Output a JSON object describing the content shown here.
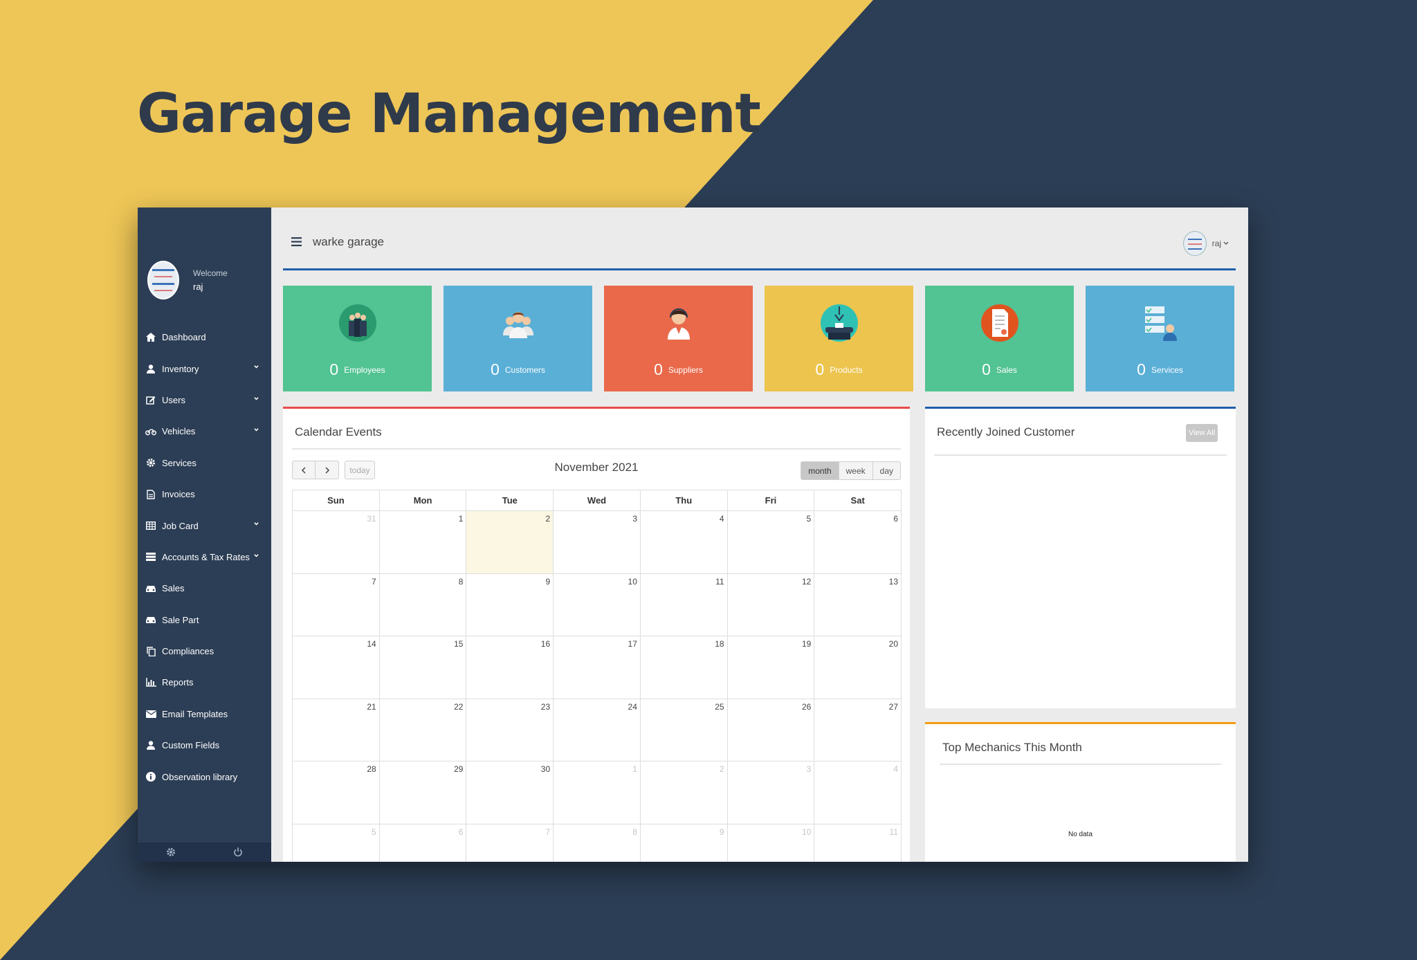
{
  "promo": {
    "title": "Garage Management"
  },
  "colors": {
    "sidebar": "#2c3e55",
    "accent_blue": "#1f5ea8",
    "calendar_border": "#e84b4b",
    "mechanics_border": "#f39c12",
    "today": "#fcf7e2"
  },
  "sidebar": {
    "welcome": "Welcome",
    "username": "raj",
    "items": [
      {
        "label": "Dashboard",
        "icon": "home-icon",
        "expandable": false
      },
      {
        "label": "Inventory",
        "icon": "user-icon",
        "expandable": true
      },
      {
        "label": "Users",
        "icon": "edit-icon",
        "expandable": true
      },
      {
        "label": "Vehicles",
        "icon": "motorcycle-icon",
        "expandable": true
      },
      {
        "label": "Services",
        "icon": "gear-icon",
        "expandable": false
      },
      {
        "label": "Invoices",
        "icon": "document-icon",
        "expandable": false
      },
      {
        "label": "Job Card",
        "icon": "table-icon",
        "expandable": true
      },
      {
        "label": "Accounts & Tax Rates",
        "icon": "server-icon",
        "expandable": true
      },
      {
        "label": "Sales",
        "icon": "car-icon",
        "expandable": false
      },
      {
        "label": "Sale Part",
        "icon": "car-icon",
        "expandable": false
      },
      {
        "label": "Compliances",
        "icon": "copy-icon",
        "expandable": false
      },
      {
        "label": "Reports",
        "icon": "bar-chart-icon",
        "expandable": false
      },
      {
        "label": "Email Templates",
        "icon": "envelope-icon",
        "expandable": false
      },
      {
        "label": "Custom Fields",
        "icon": "user-icon",
        "expandable": false
      },
      {
        "label": "Observation library",
        "icon": "info-icon",
        "expandable": false
      }
    ],
    "footer": {
      "settings_icon": "gear-icon",
      "power_icon": "power-icon"
    }
  },
  "topbar": {
    "app_name": "warke garage",
    "user": "raj"
  },
  "tiles": [
    {
      "count": "0",
      "label": "Employees",
      "color": "#52c393",
      "icon": "employees-icon"
    },
    {
      "count": "0",
      "label": "Customers",
      "color": "#5aafd6",
      "icon": "customers-icon"
    },
    {
      "count": "0",
      "label": "Suppliers",
      "color": "#e9694a",
      "icon": "supplier-icon"
    },
    {
      "count": "0",
      "label": "Products",
      "color": "#ecc44e",
      "icon": "products-icon"
    },
    {
      "count": "0",
      "label": "Sales",
      "color": "#52c393",
      "icon": "sales-icon"
    },
    {
      "count": "0",
      "label": "Services",
      "color": "#5aafd6",
      "icon": "services-icon"
    }
  ],
  "calendar": {
    "title": "Calendar Events",
    "month": "November 2021",
    "today_label": "today",
    "views": [
      "month",
      "week",
      "day"
    ],
    "active_view": "month",
    "days_of_week": [
      "Sun",
      "Mon",
      "Tue",
      "Wed",
      "Thu",
      "Fri",
      "Sat"
    ],
    "weeks": [
      [
        {
          "d": "31",
          "o": true
        },
        {
          "d": "1"
        },
        {
          "d": "2",
          "today": true
        },
        {
          "d": "3"
        },
        {
          "d": "4"
        },
        {
          "d": "5"
        },
        {
          "d": "6"
        }
      ],
      [
        {
          "d": "7"
        },
        {
          "d": "8"
        },
        {
          "d": "9"
        },
        {
          "d": "10"
        },
        {
          "d": "11"
        },
        {
          "d": "12"
        },
        {
          "d": "13"
        }
      ],
      [
        {
          "d": "14"
        },
        {
          "d": "15"
        },
        {
          "d": "16"
        },
        {
          "d": "17"
        },
        {
          "d": "18"
        },
        {
          "d": "19"
        },
        {
          "d": "20"
        }
      ],
      [
        {
          "d": "21"
        },
        {
          "d": "22"
        },
        {
          "d": "23"
        },
        {
          "d": "24"
        },
        {
          "d": "25"
        },
        {
          "d": "26"
        },
        {
          "d": "27"
        }
      ],
      [
        {
          "d": "28"
        },
        {
          "d": "29"
        },
        {
          "d": "30"
        },
        {
          "d": "1",
          "o": true
        },
        {
          "d": "2",
          "o": true
        },
        {
          "d": "3",
          "o": true
        },
        {
          "d": "4",
          "o": true
        }
      ],
      [
        {
          "d": "5",
          "o": true
        },
        {
          "d": "6",
          "o": true
        },
        {
          "d": "7",
          "o": true
        },
        {
          "d": "8",
          "o": true
        },
        {
          "d": "9",
          "o": true
        },
        {
          "d": "10",
          "o": true
        },
        {
          "d": "11",
          "o": true
        }
      ]
    ]
  },
  "recent_customers": {
    "title": "Recently Joined Customer",
    "view_all": "View All"
  },
  "top_mechanics": {
    "title": "Top Mechanics This Month",
    "empty_text": "No data"
  }
}
